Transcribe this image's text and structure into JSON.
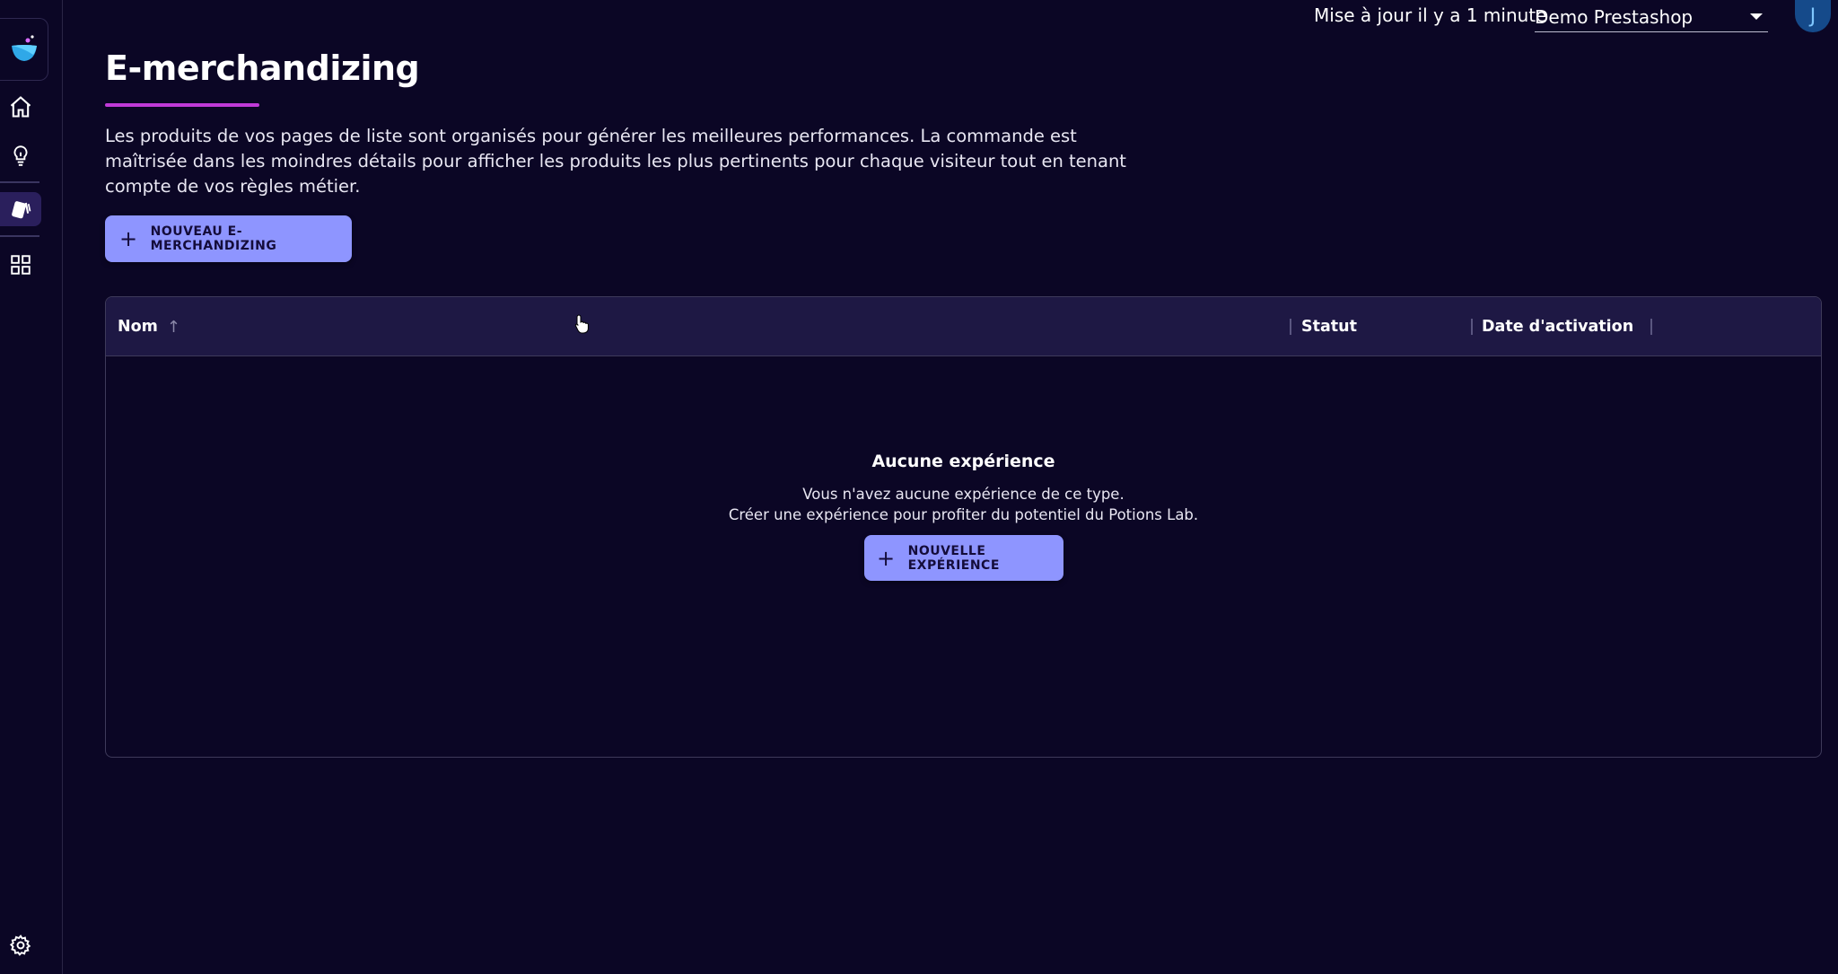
{
  "header": {
    "status": "Mise à jour il y a 1 minute",
    "shop_selected": "Demo Prestashop",
    "avatar_initial": "J"
  },
  "sidebar": {
    "items": [
      {
        "name": "home",
        "icon": "home-icon"
      },
      {
        "name": "ideas",
        "icon": "lightbulb-icon"
      },
      {
        "name": "experiences",
        "icon": "cards-icon",
        "active": true
      },
      {
        "name": "apps",
        "icon": "grid-icon"
      },
      {
        "name": "settings",
        "icon": "gear-icon"
      }
    ]
  },
  "page": {
    "title": "E-merchandizing",
    "description": "Les produits de vos pages de liste sont organisés pour générer les meilleures performances. La commande est maîtrisée dans les moindres détails pour afficher les produits les plus pertinents pour chaque visiteur tout en tenant compte de vos règles métier.",
    "new_button": "NOUVEAU E-MERCHANDIZING"
  },
  "table": {
    "columns": [
      "Nom",
      "Statut",
      "Date d'activation"
    ],
    "empty": {
      "title": "Aucune expérience",
      "line1": "Vous n'avez aucune expérience de ce type.",
      "line2": "Créer une expérience pour profiter du potentiel du Potions Lab.",
      "button": "NOUVELLE EXPÉRIENCE"
    }
  },
  "colors": {
    "background": "#0b0625",
    "accent_button": "#8e95ff",
    "title_underline": "#c03ad8",
    "table_header": "#1e1844"
  }
}
